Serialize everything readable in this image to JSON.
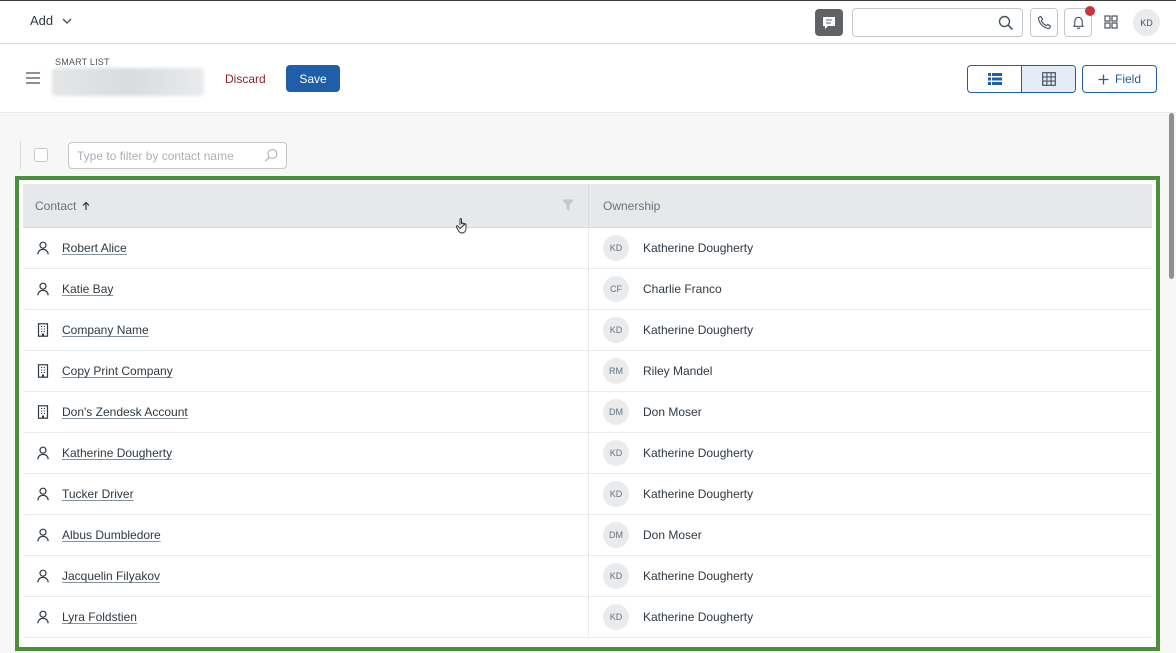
{
  "topbar": {
    "add_label": "Add",
    "search_placeholder": "",
    "user_initials": "KD"
  },
  "header": {
    "smart_list_label": "SMART LIST",
    "discard_label": "Discard",
    "save_label": "Save",
    "field_label": "Field"
  },
  "filter": {
    "placeholder": "Type to filter by contact name"
  },
  "table": {
    "columns": [
      "Contact",
      "Ownership"
    ],
    "sort_icon": "arrow-up-icon",
    "rows": [
      {
        "type": "person",
        "contact": "Robert Alice",
        "owner_initials": "KD",
        "owner": "Katherine Dougherty"
      },
      {
        "type": "person",
        "contact": "Katie Bay",
        "owner_initials": "CF",
        "owner": "Charlie Franco"
      },
      {
        "type": "company",
        "contact": "Company Name",
        "owner_initials": "KD",
        "owner": "Katherine Dougherty"
      },
      {
        "type": "company",
        "contact": "Copy Print Company",
        "owner_initials": "RM",
        "owner": "Riley Mandel"
      },
      {
        "type": "company",
        "contact": "Don's Zendesk Account",
        "owner_initials": "DM",
        "owner": "Don Moser"
      },
      {
        "type": "person",
        "contact": "Katherine Dougherty",
        "owner_initials": "KD",
        "owner": "Katherine Dougherty"
      },
      {
        "type": "person",
        "contact": "Tucker Driver",
        "owner_initials": "KD",
        "owner": "Katherine Dougherty"
      },
      {
        "type": "person",
        "contact": "Albus Dumbledore",
        "owner_initials": "DM",
        "owner": "Don Moser"
      },
      {
        "type": "person",
        "contact": "Jacquelin Filyakov",
        "owner_initials": "KD",
        "owner": "Katherine Dougherty"
      },
      {
        "type": "person",
        "contact": "Lyra Foldstien",
        "owner_initials": "KD",
        "owner": "Katherine Dougherty"
      }
    ]
  },
  "colors": {
    "primary": "#1f5ea8",
    "discard": "#8c232c",
    "highlight_border": "#4a8f3b",
    "notification": "#cc3340"
  }
}
